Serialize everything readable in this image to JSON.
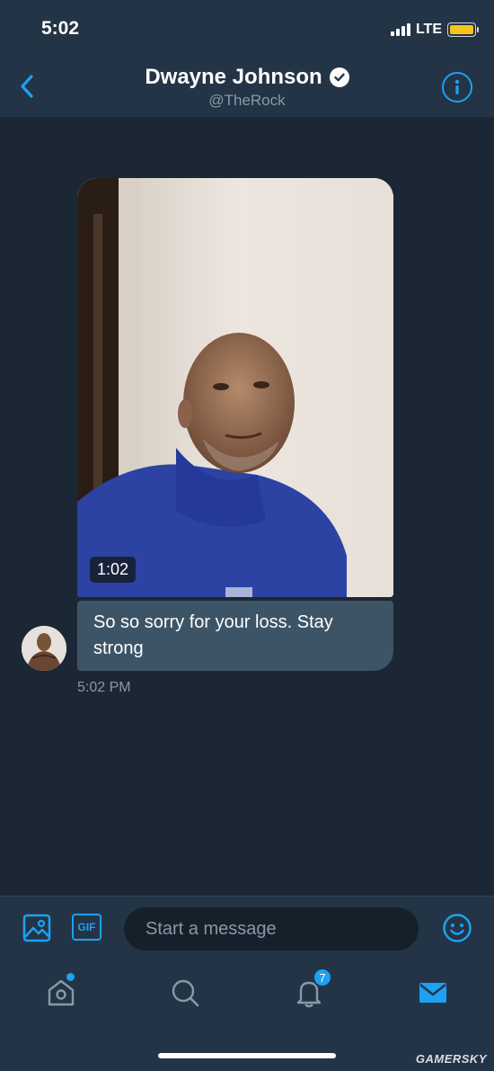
{
  "status_bar": {
    "time": "5:02",
    "network": "LTE"
  },
  "header": {
    "name": "Dwayne Johnson",
    "handle": "@TheRock",
    "verified": true
  },
  "conversation": {
    "video_duration": "1:02",
    "message_text": "So so sorry for your loss. Stay strong",
    "message_time": "5:02 PM"
  },
  "composer": {
    "placeholder": "Start a message",
    "gif_label": "GIF"
  },
  "tabbar": {
    "notifications_count": "7",
    "active_tab": "messages"
  },
  "watermark": "GAMERSKY",
  "colors": {
    "accent": "#1da1f2",
    "background": "#1c2735",
    "bar": "#243447",
    "bubble": "#3d5466"
  }
}
